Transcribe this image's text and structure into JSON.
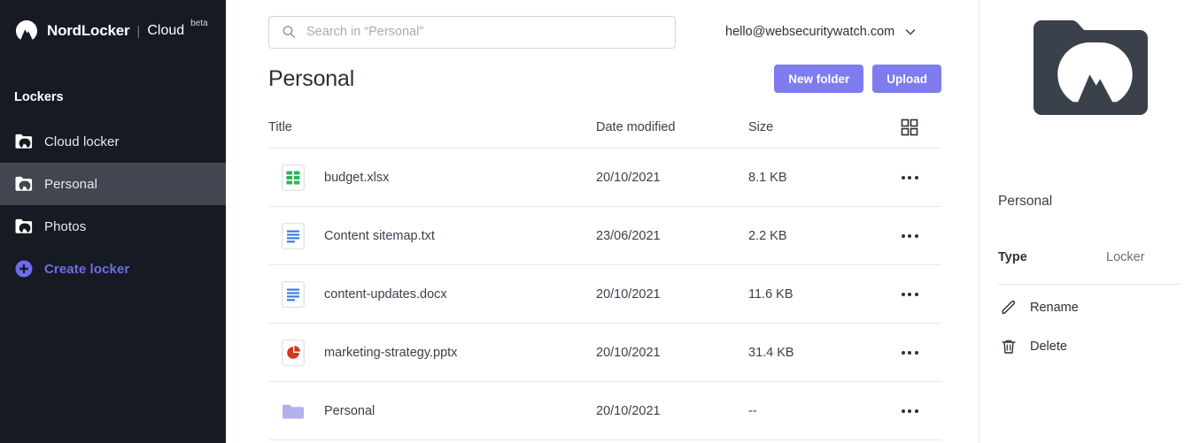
{
  "brand": {
    "name": "NordLocker",
    "divider": "|",
    "product": "Cloud",
    "badge": "beta",
    "logo_icon": "nordlocker-mountain-logo"
  },
  "sidebar": {
    "heading": "Lockers",
    "items": [
      {
        "label": "Cloud locker",
        "icon": "locker-folder-icon",
        "selected": false
      },
      {
        "label": "Personal",
        "icon": "locker-folder-icon",
        "selected": true
      },
      {
        "label": "Photos",
        "icon": "locker-folder-icon",
        "selected": false
      }
    ],
    "create": {
      "label": "Create locker",
      "icon": "plus-circle-icon"
    },
    "colors": {
      "background": "#161a23",
      "selected": "#424650",
      "accent": "#6f6ce9"
    }
  },
  "search": {
    "placeholder": "Search in “Personal”",
    "value": "",
    "icon": "search-icon"
  },
  "account": {
    "email": "hello@websecuritywatch.com",
    "chevron_icon": "chevron-down-icon"
  },
  "page": {
    "title": "Personal",
    "new_folder_label": "New folder",
    "upload_label": "Upload",
    "button_color": "#7e7cef"
  },
  "table": {
    "headers": {
      "title": "Title",
      "date": "Date modified",
      "size": "Size",
      "view_toggle_icon": "grid-view-icon"
    },
    "rows": [
      {
        "name": "budget.xlsx",
        "date": "20/10/2021",
        "size": "8.1 KB",
        "icon": "spreadsheet-file-icon"
      },
      {
        "name": "Content sitemap.txt",
        "date": "23/06/2021",
        "size": "2.2 KB",
        "icon": "text-file-icon"
      },
      {
        "name": "content-updates.docx",
        "date": "20/10/2021",
        "size": "11.6 KB",
        "icon": "document-file-icon"
      },
      {
        "name": "marketing-strategy.pptx",
        "date": "20/10/2021",
        "size": "31.4 KB",
        "icon": "presentation-file-icon"
      },
      {
        "name": "Personal",
        "date": "20/10/2021",
        "size": "--",
        "icon": "folder-icon"
      }
    ],
    "row_menu_icon": "more-options-icon"
  },
  "details": {
    "thumb_icon": "nordlocker-folder-logo",
    "name": "Personal",
    "type_key": "Type",
    "type_value": "Locker",
    "actions": [
      {
        "label": "Rename",
        "icon": "pencil-icon"
      },
      {
        "label": "Delete",
        "icon": "trash-icon"
      }
    ]
  }
}
